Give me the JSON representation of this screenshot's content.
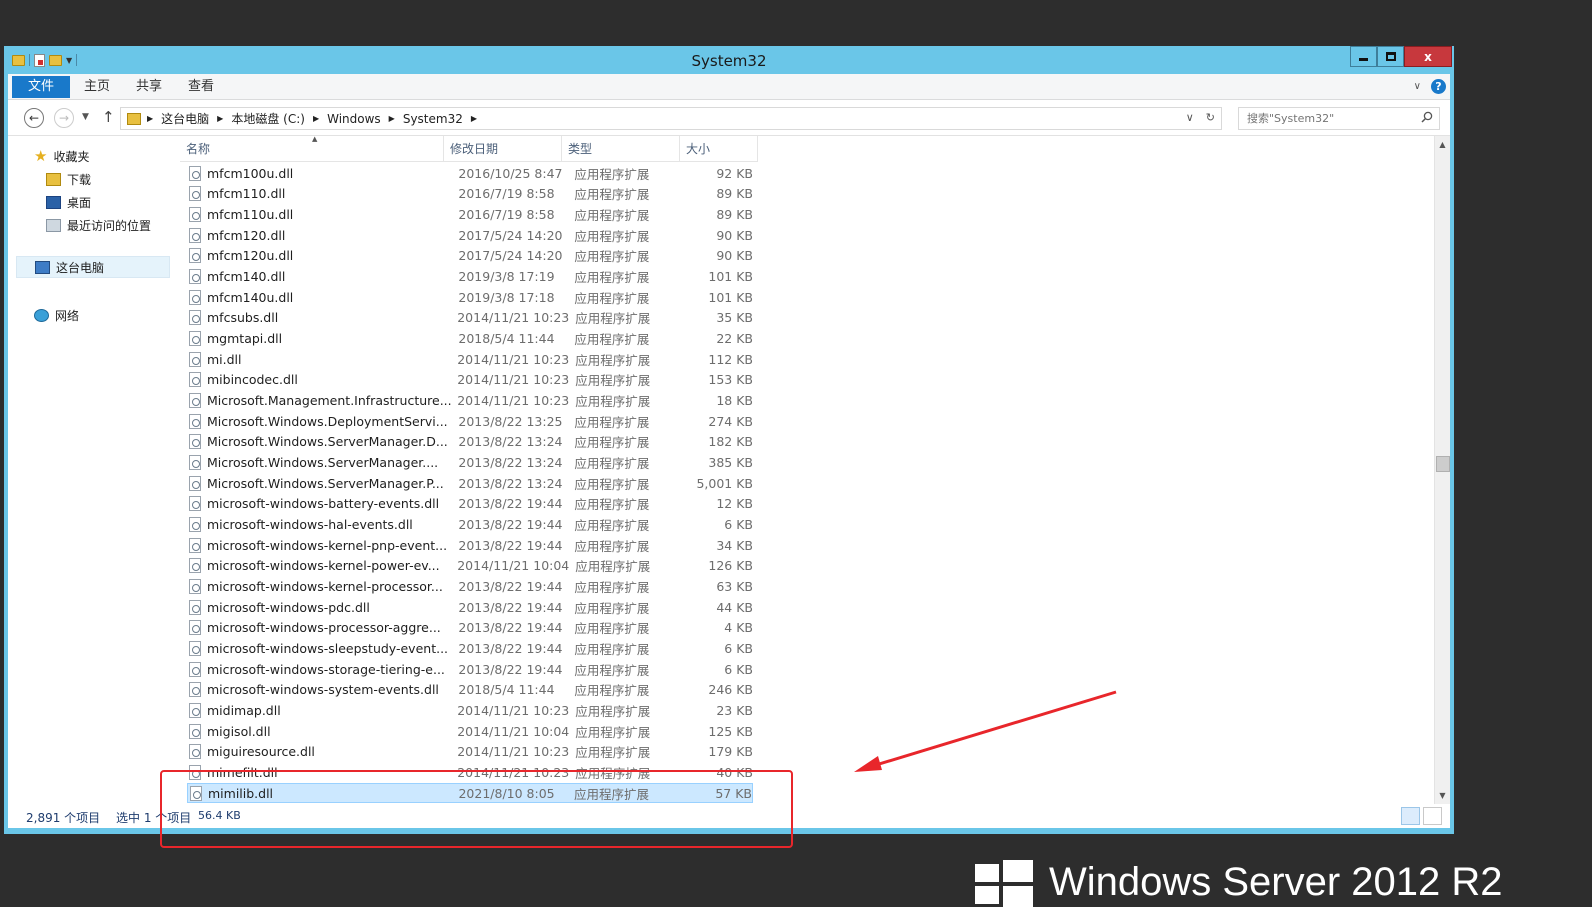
{
  "window": {
    "title": "System32",
    "close_glyph": "x"
  },
  "ribbon": {
    "tabs": [
      "文件",
      "主页",
      "共享",
      "查看"
    ],
    "help_glyph": "?"
  },
  "address": {
    "crumbs": [
      "这台电脑",
      "本地磁盘 (C:)",
      "Windows",
      "System32"
    ],
    "search_placeholder": "搜索\"System32\""
  },
  "sidebar": {
    "favorites": "收藏夹",
    "downloads": "下载",
    "desktop": "桌面",
    "recent": "最近访问的位置",
    "this_pc": "这台电脑",
    "network": "网络"
  },
  "columns": [
    "名称",
    "修改日期",
    "类型",
    "大小"
  ],
  "files": [
    {
      "name": "mfcm100u.dll",
      "date": "2016/10/25 8:47",
      "type": "应用程序扩展",
      "size": "92 KB"
    },
    {
      "name": "mfcm110.dll",
      "date": "2016/7/19 8:58",
      "type": "应用程序扩展",
      "size": "89 KB"
    },
    {
      "name": "mfcm110u.dll",
      "date": "2016/7/19 8:58",
      "type": "应用程序扩展",
      "size": "89 KB"
    },
    {
      "name": "mfcm120.dll",
      "date": "2017/5/24 14:20",
      "type": "应用程序扩展",
      "size": "90 KB"
    },
    {
      "name": "mfcm120u.dll",
      "date": "2017/5/24 14:20",
      "type": "应用程序扩展",
      "size": "90 KB"
    },
    {
      "name": "mfcm140.dll",
      "date": "2019/3/8 17:19",
      "type": "应用程序扩展",
      "size": "101 KB"
    },
    {
      "name": "mfcm140u.dll",
      "date": "2019/3/8 17:18",
      "type": "应用程序扩展",
      "size": "101 KB"
    },
    {
      "name": "mfcsubs.dll",
      "date": "2014/11/21 10:23",
      "type": "应用程序扩展",
      "size": "35 KB"
    },
    {
      "name": "mgmtapi.dll",
      "date": "2018/5/4 11:44",
      "type": "应用程序扩展",
      "size": "22 KB"
    },
    {
      "name": "mi.dll",
      "date": "2014/11/21 10:23",
      "type": "应用程序扩展",
      "size": "112 KB"
    },
    {
      "name": "mibincodec.dll",
      "date": "2014/11/21 10:23",
      "type": "应用程序扩展",
      "size": "153 KB"
    },
    {
      "name": "Microsoft.Management.Infrastructure...",
      "date": "2014/11/21 10:23",
      "type": "应用程序扩展",
      "size": "18 KB"
    },
    {
      "name": "Microsoft.Windows.DeploymentServi...",
      "date": "2013/8/22 13:25",
      "type": "应用程序扩展",
      "size": "274 KB"
    },
    {
      "name": "Microsoft.Windows.ServerManager.D...",
      "date": "2013/8/22 13:24",
      "type": "应用程序扩展",
      "size": "182 KB"
    },
    {
      "name": "Microsoft.Windows.ServerManager....",
      "date": "2013/8/22 13:24",
      "type": "应用程序扩展",
      "size": "385 KB"
    },
    {
      "name": "Microsoft.Windows.ServerManager.P...",
      "date": "2013/8/22 13:24",
      "type": "应用程序扩展",
      "size": "5,001 KB"
    },
    {
      "name": "microsoft-windows-battery-events.dll",
      "date": "2013/8/22 19:44",
      "type": "应用程序扩展",
      "size": "12 KB"
    },
    {
      "name": "microsoft-windows-hal-events.dll",
      "date": "2013/8/22 19:44",
      "type": "应用程序扩展",
      "size": "6 KB"
    },
    {
      "name": "microsoft-windows-kernel-pnp-event...",
      "date": "2013/8/22 19:44",
      "type": "应用程序扩展",
      "size": "34 KB"
    },
    {
      "name": "microsoft-windows-kernel-power-ev...",
      "date": "2014/11/21 10:04",
      "type": "应用程序扩展",
      "size": "126 KB"
    },
    {
      "name": "microsoft-windows-kernel-processor...",
      "date": "2013/8/22 19:44",
      "type": "应用程序扩展",
      "size": "63 KB"
    },
    {
      "name": "microsoft-windows-pdc.dll",
      "date": "2013/8/22 19:44",
      "type": "应用程序扩展",
      "size": "44 KB"
    },
    {
      "name": "microsoft-windows-processor-aggre...",
      "date": "2013/8/22 19:44",
      "type": "应用程序扩展",
      "size": "4 KB"
    },
    {
      "name": "microsoft-windows-sleepstudy-event...",
      "date": "2013/8/22 19:44",
      "type": "应用程序扩展",
      "size": "6 KB"
    },
    {
      "name": "microsoft-windows-storage-tiering-e...",
      "date": "2013/8/22 19:44",
      "type": "应用程序扩展",
      "size": "6 KB"
    },
    {
      "name": "microsoft-windows-system-events.dll",
      "date": "2018/5/4 11:44",
      "type": "应用程序扩展",
      "size": "246 KB"
    },
    {
      "name": "midimap.dll",
      "date": "2014/11/21 10:23",
      "type": "应用程序扩展",
      "size": "23 KB"
    },
    {
      "name": "migisol.dll",
      "date": "2014/11/21 10:04",
      "type": "应用程序扩展",
      "size": "125 KB"
    },
    {
      "name": "miguiresource.dll",
      "date": "2014/11/21 10:23",
      "type": "应用程序扩展",
      "size": "179 KB"
    },
    {
      "name": "mimefilt.dll",
      "date": "2014/11/21 10:23",
      "type": "应用程序扩展",
      "size": "40 KB"
    },
    {
      "name": "mimilib.dll",
      "date": "2021/8/10 8:05",
      "type": "应用程序扩展",
      "size": "57 KB",
      "selected": true
    }
  ],
  "status": {
    "count": "2,891 个项目",
    "selected": "选中 1 个项目",
    "size": "56.4 KB"
  },
  "brand": {
    "text": "Windows Server 2012 R2"
  },
  "colors": {
    "titlebar": "#6ac6e8",
    "file_tab": "#1979ca",
    "selection": "#cce8ff",
    "annotation": "#e8262b"
  }
}
